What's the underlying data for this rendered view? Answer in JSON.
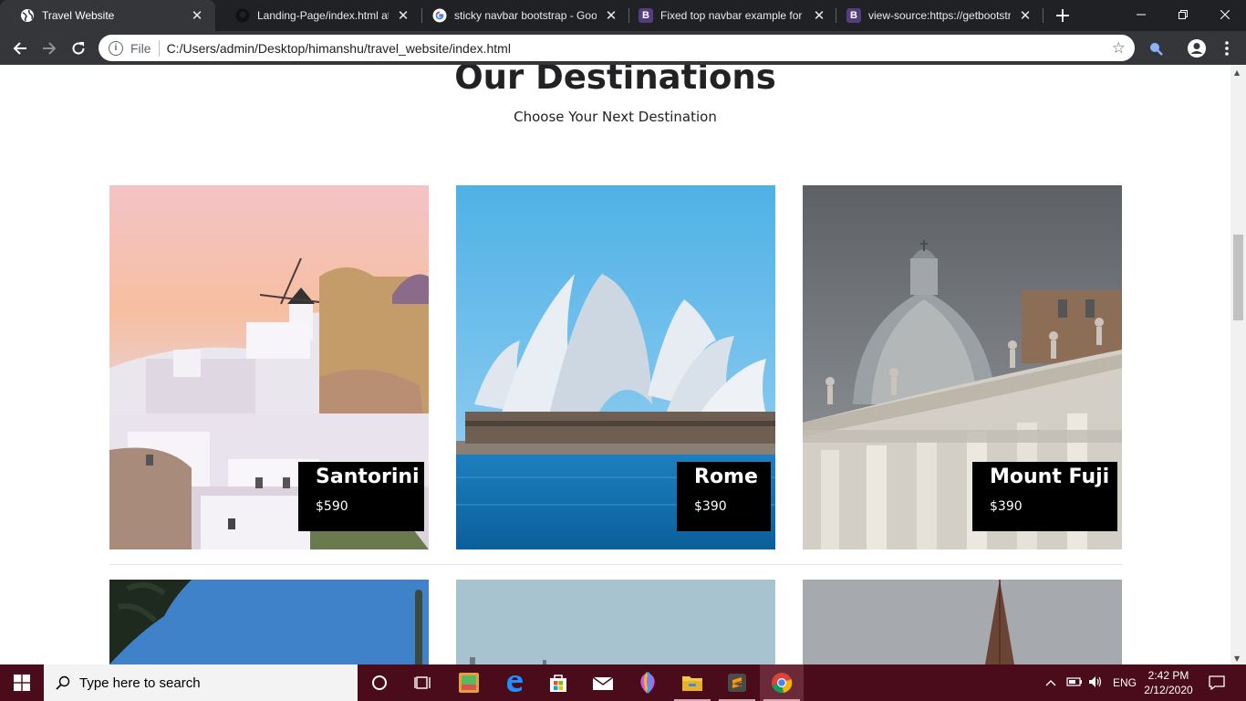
{
  "browser": {
    "tabs": [
      {
        "title": "Travel Website",
        "favicon": "globe-icon",
        "active": true
      },
      {
        "title": "Landing-Page/index.html at m",
        "favicon": "github-icon",
        "active": false
      },
      {
        "title": "sticky navbar bootstrap - Goog",
        "favicon": "google-icon",
        "active": false
      },
      {
        "title": "Fixed top navbar example for B",
        "favicon": "bootstrap-icon",
        "active": false
      },
      {
        "title": "view-source:https://getbootstr",
        "favicon": "bootstrap-icon",
        "active": false
      }
    ],
    "bootstrap_letter": "B",
    "address": {
      "scheme": "File",
      "url": "C:/Users/admin/Desktop/himanshu/travel_website/index.html"
    }
  },
  "page": {
    "section_title": "Our Destinations",
    "section_subtitle": "Choose Your Next Destination",
    "destinations": [
      {
        "name": "Santorini",
        "price": "$590"
      },
      {
        "name": "Rome",
        "price": "$390"
      },
      {
        "name": "Mount Fuji",
        "price": "$390"
      }
    ]
  },
  "taskbar": {
    "search_placeholder": "Type here to search",
    "apps": [
      "cortana-icon",
      "task-view-icon",
      "paint-3d-icon",
      "edge-icon",
      "store-icon",
      "mail-icon",
      "paint-app-icon",
      "file-explorer-icon",
      "sublime-text-icon",
      "chrome-icon"
    ],
    "language": "ENG",
    "time": "2:42 PM",
    "date": "2/12/2020"
  },
  "colors": {
    "caption_bg": "#000000",
    "taskbar_bg": "#4a0c1b",
    "chrome_dark": "#202124"
  }
}
